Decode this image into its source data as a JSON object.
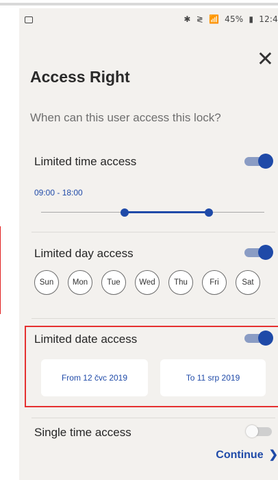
{
  "status_bar": {
    "left_icon": "image-icon",
    "right_text": [
      "✱",
      "≷",
      "📶",
      "45%",
      "▮",
      "12:4"
    ]
  },
  "header": {
    "close_icon": "✕",
    "title": "Access Right",
    "subtitle": "When can this user access this lock?"
  },
  "limited_time": {
    "label": "Limited time access",
    "enabled": true,
    "range_text": "09:00 - 18:00",
    "range_start_fraction": 0.375,
    "range_end_fraction": 0.75
  },
  "limited_day": {
    "label": "Limited day access",
    "enabled": true,
    "days": [
      "Sun",
      "Mon",
      "Tue",
      "Wed",
      "Thu",
      "Fri",
      "Sat"
    ]
  },
  "limited_date": {
    "label": "Limited date access",
    "enabled": true,
    "from_label": "From 12 čvc 2019",
    "to_label": "To 11 srp 2019"
  },
  "single_time": {
    "label": "Single time access",
    "enabled": false
  },
  "footer": {
    "continue_label": "Continue",
    "continue_chevron": "❯"
  },
  "colors": {
    "accent": "#1f4aa8",
    "background": "#f3f1ee",
    "highlight": "#e53030"
  }
}
